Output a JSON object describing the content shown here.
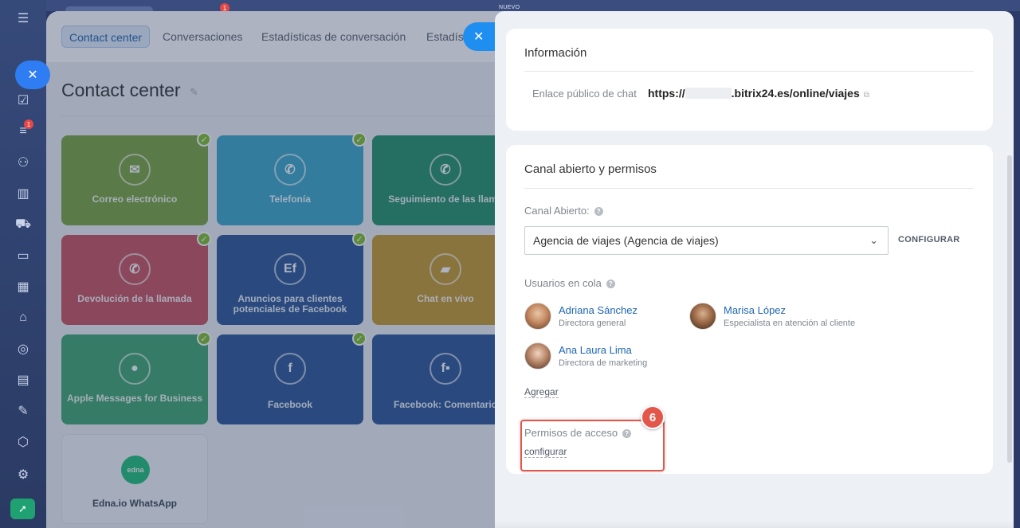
{
  "top": {
    "badge": "1",
    "nuevo": "NUEVO"
  },
  "sidebar": {
    "badge": "1"
  },
  "contact_center": {
    "tabs": [
      {
        "label": "Contact center"
      },
      {
        "label": "Conversaciones"
      },
      {
        "label": "Estadísticas de conversación"
      },
      {
        "label": "Estadíst"
      }
    ],
    "title": "Contact center",
    "tiles": [
      {
        "label": "Correo electrónico"
      },
      {
        "label": "Telefonía"
      },
      {
        "label": "Seguimiento de las llama"
      },
      {
        "label": "Devolución de la llamada"
      },
      {
        "label": "Anuncios para clientes potenciales de Facebook"
      },
      {
        "label": "Chat en vivo"
      },
      {
        "label": "Apple Messages for Business"
      },
      {
        "label": "Facebook"
      },
      {
        "label": "Facebook: Comentario"
      },
      {
        "label": "Edna.io WhatsApp"
      }
    ],
    "edna_logo_text": "edna"
  },
  "info_card": {
    "title": "Información",
    "public_link_label": "Enlace público de chat",
    "public_link_prefix": "https://",
    "public_link_suffix": ".bitrix24.es/online/viajes"
  },
  "channel_card": {
    "title": "Canal abierto y permisos",
    "open_channel_label": "Canal Abierto:",
    "open_channel_value": "Agencia de viajes (Agencia de viajes)",
    "configure_button": "CONFIGURAR",
    "queue_label": "Usuarios en cola",
    "users": [
      {
        "name": "Adriana Sánchez",
        "role": "Directora general"
      },
      {
        "name": "Marisa López",
        "role": "Especialista en atención al cliente"
      },
      {
        "name": "Ana Laura Lima",
        "role": "Directora de marketing"
      }
    ],
    "add_link": "Agregar",
    "access_label": "Permisos de acceso",
    "access_link": "configurar",
    "step_number": "6"
  },
  "colors": {
    "accent": "#2067b0",
    "highlight": "#e3574b",
    "check": "#7fbf2a"
  }
}
